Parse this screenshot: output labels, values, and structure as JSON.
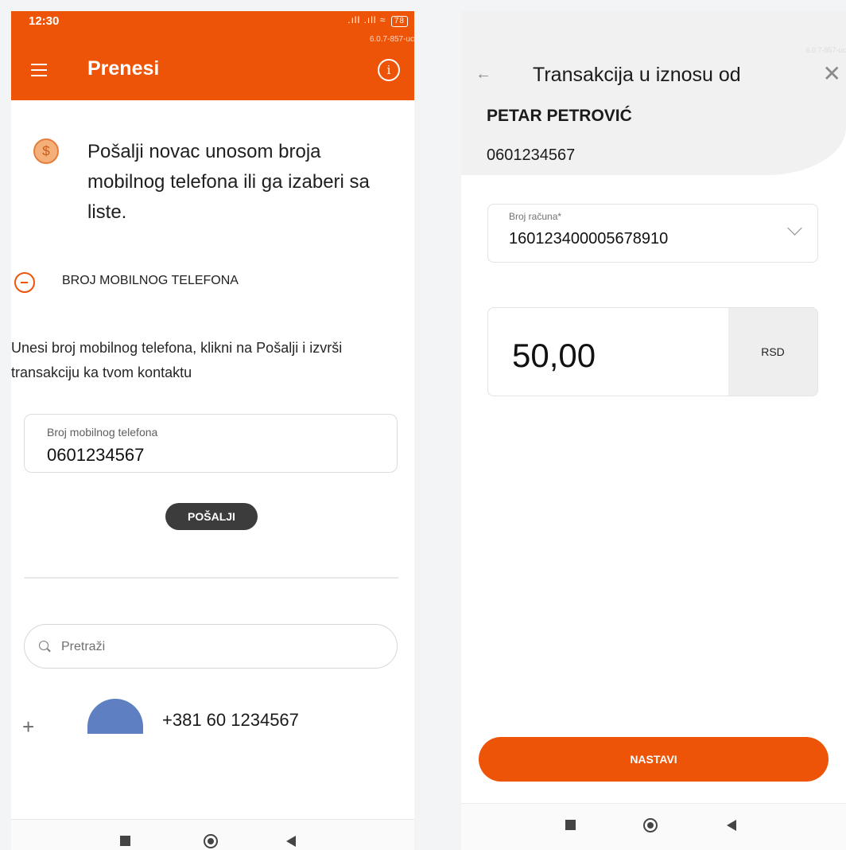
{
  "left": {
    "status": {
      "time": "12:30",
      "signal": ".ıll .ıll ≈",
      "battery": "78"
    },
    "version": "6.0.7-857-uc",
    "title": "Prenesi",
    "intro": "Pošalji novac unosom broja mobilnog telefona ili ga izaberi sa liste.",
    "section_title": "BROJ MOBILNOG TELEFONA",
    "instruction": "Unesi broj mobilnog telefona, klikni na Pošalji i izvrši transakciju ka tvom kontaktu",
    "phone_field": {
      "label": "Broj mobilnog telefona",
      "value": "0601234567"
    },
    "send_button": "POŠALJI",
    "search": {
      "placeholder": "Pretraži"
    },
    "contact": {
      "number": "+381 60 1234567"
    },
    "icons": [
      "menu-icon",
      "info-icon",
      "dollar-coin-icon",
      "minus-circle-icon",
      "search-icon",
      "plus-icon"
    ]
  },
  "right": {
    "version": "6.0.7-857-uc",
    "title": "Transakcija u iznosu od",
    "recipient": {
      "name": "PETAR PETROVIĆ",
      "phone": "0601234567"
    },
    "account": {
      "label": "Broj računa*",
      "value": "160123400005678910"
    },
    "amount": {
      "value": "50,00",
      "currency": "RSD"
    },
    "continue_button": "NASTAVI",
    "icons": [
      "back-arrow-icon",
      "close-icon",
      "chevron-down-icon"
    ]
  },
  "colors": {
    "brand": "#ee5408",
    "dark_button": "#3c3c3c",
    "avatar": "#5e7fc2"
  }
}
